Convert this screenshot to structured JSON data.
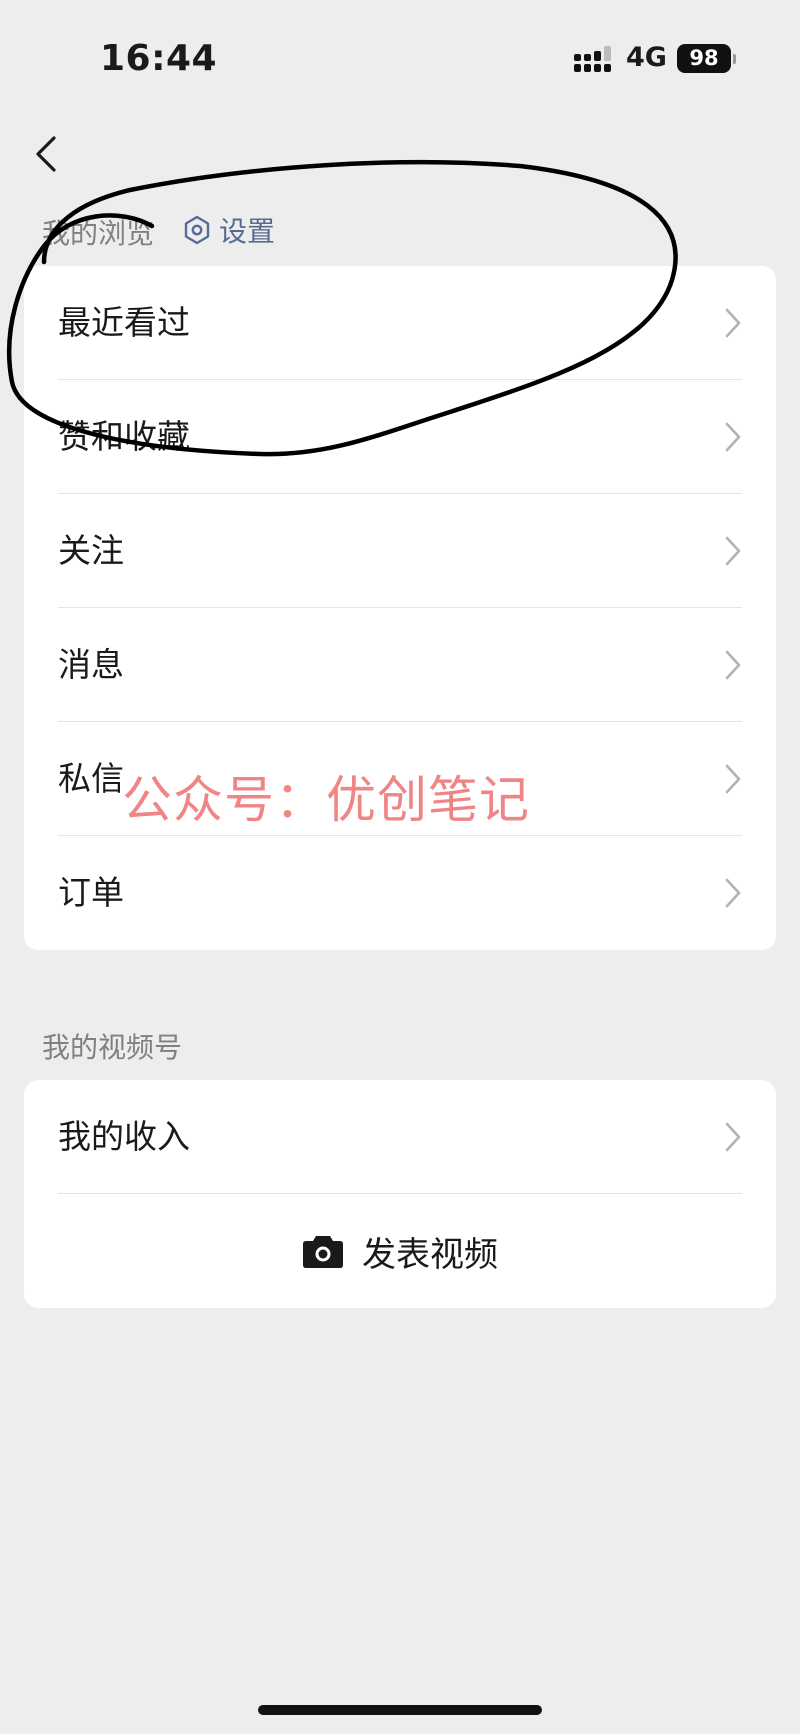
{
  "status_bar": {
    "time": "16:44",
    "network": "4G",
    "battery": "98"
  },
  "browsing": {
    "title": "我的浏览",
    "settings_label": "设置",
    "items": [
      {
        "label": "最近看过"
      },
      {
        "label": "赞和收藏"
      },
      {
        "label": "关注"
      },
      {
        "label": "消息"
      },
      {
        "label": "私信"
      },
      {
        "label": "订单"
      }
    ]
  },
  "channels": {
    "title": "我的视频号",
    "income_label": "我的收入",
    "publish_label": "发表视频"
  },
  "watermark": "公众号：优创笔记",
  "colors": {
    "background": "#ededed",
    "link_blue": "#576b95",
    "watermark_red": "#f08585"
  }
}
